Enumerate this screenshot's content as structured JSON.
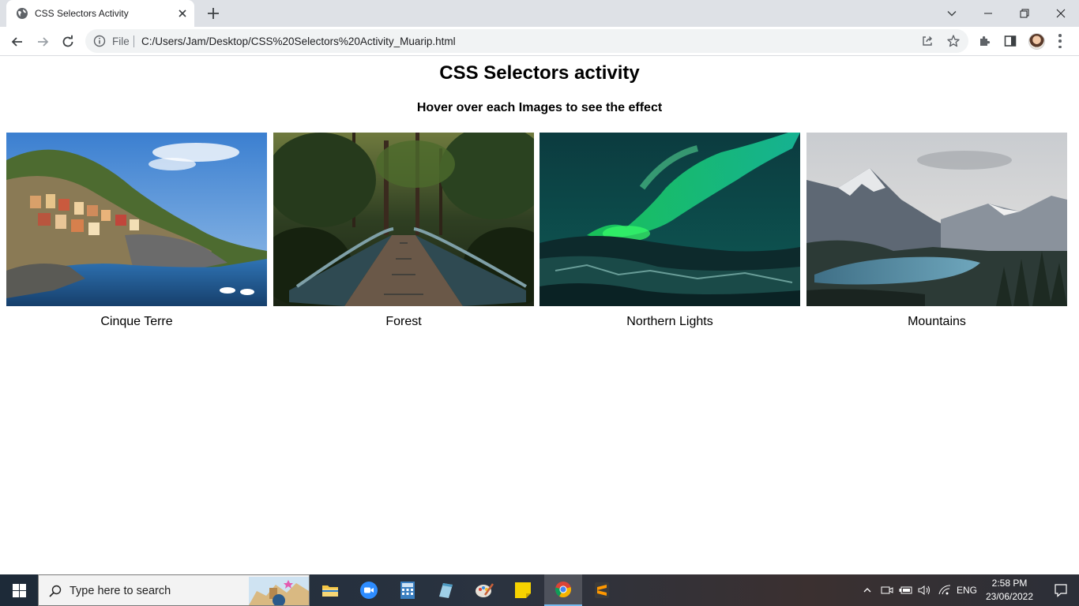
{
  "browser": {
    "tab_title": "CSS Selectors Activity",
    "address_scheme_label": "File",
    "address_url": "C:/Users/Jam/Desktop/CSS%20Selectors%20Activity_Muarip.html"
  },
  "page": {
    "heading": "CSS Selectors activity",
    "subheading": "Hover over each Images to see the effect",
    "gallery": [
      {
        "caption": "Cinque Terre"
      },
      {
        "caption": "Forest"
      },
      {
        "caption": "Northern Lights"
      },
      {
        "caption": "Mountains"
      }
    ]
  },
  "taskbar": {
    "search_placeholder": "Type here to search",
    "language": "ENG",
    "time": "2:58 PM",
    "date": "23/06/2022"
  },
  "colors": {
    "tab_strip": "#dee1e6",
    "omnibox": "#f1f3f4",
    "taskbar_active_underline": "#76b9ed"
  }
}
